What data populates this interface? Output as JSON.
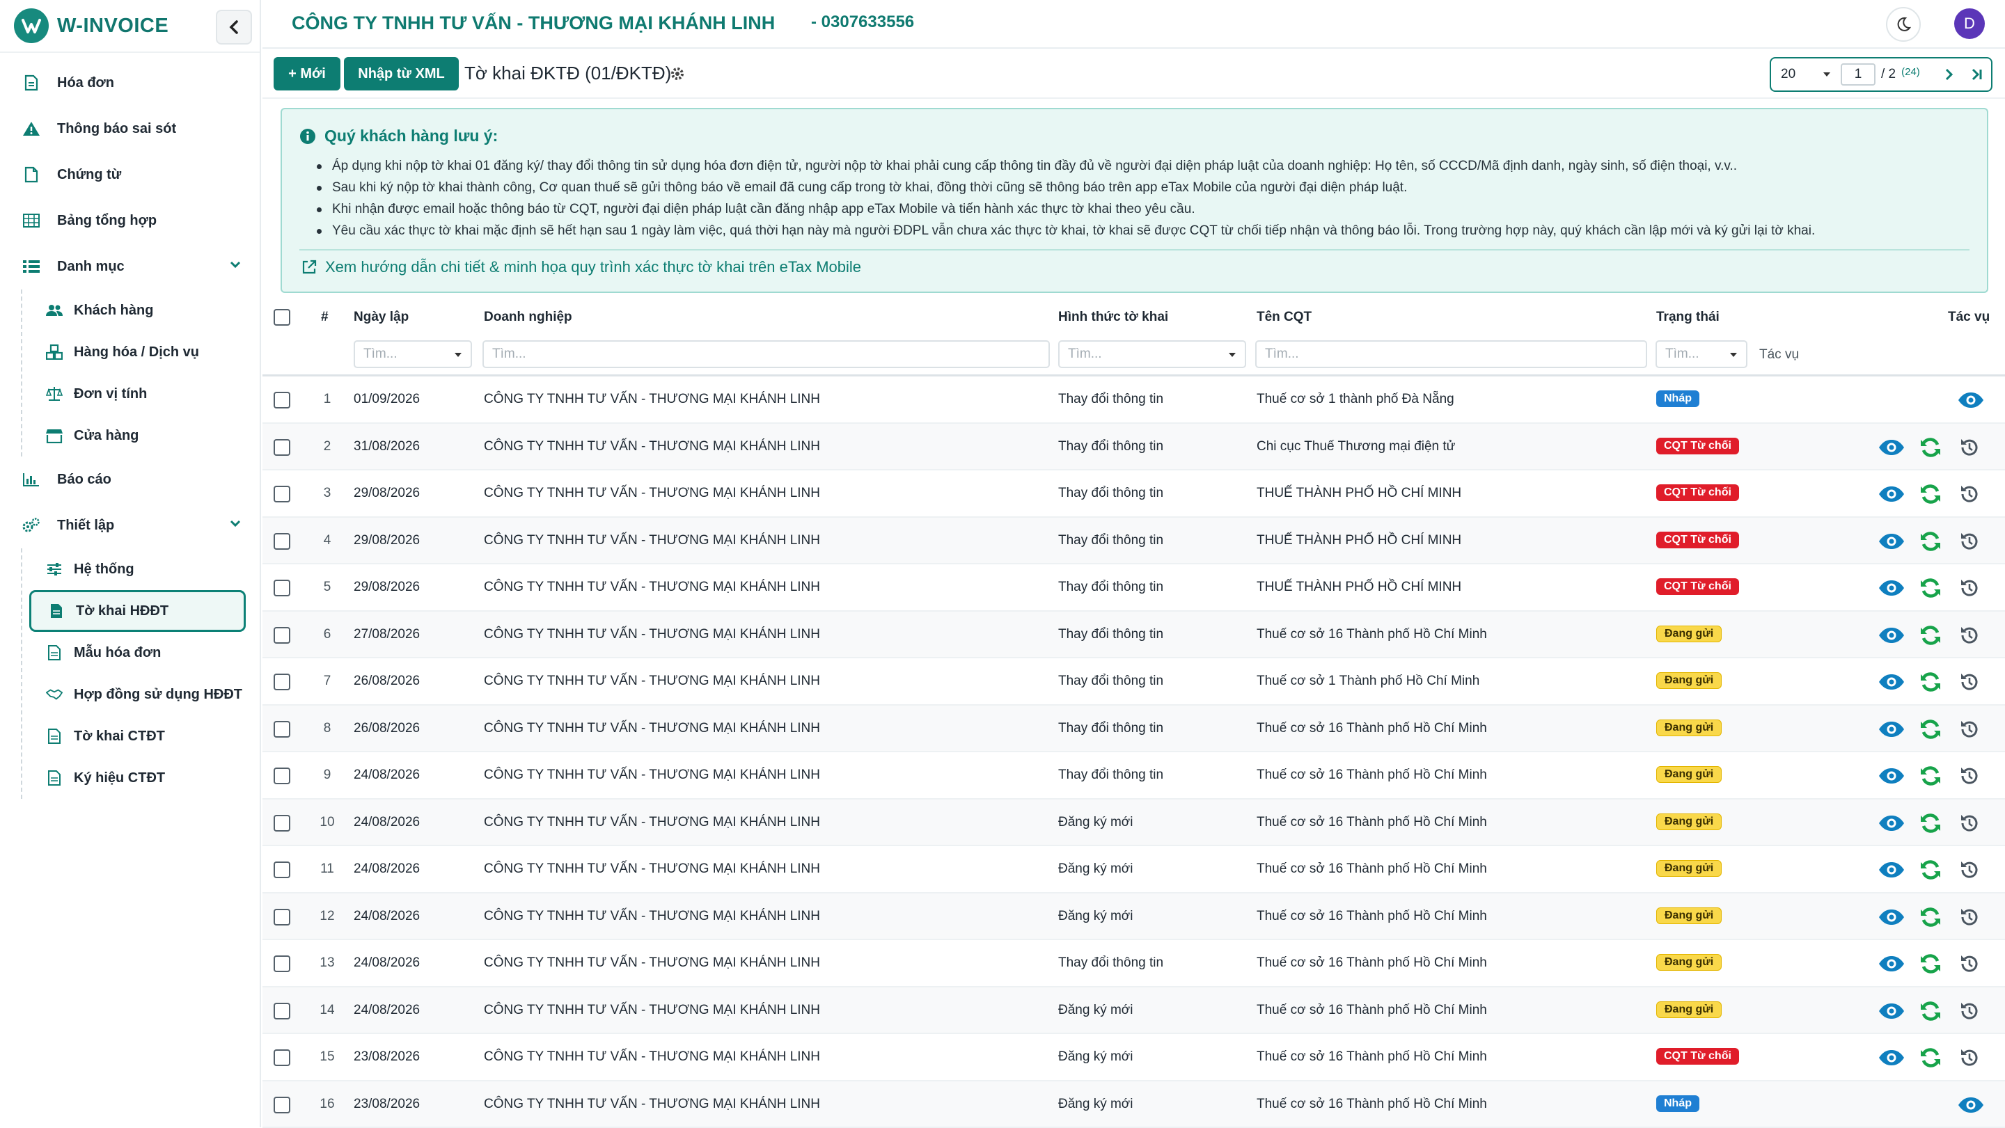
{
  "sidebar": {
    "brand": "W-INVOICE",
    "items": [
      {
        "label": "Hóa đơn"
      },
      {
        "label": "Thông báo sai sót"
      },
      {
        "label": "Chứng từ"
      },
      {
        "label": "Bảng tổng hợp"
      },
      {
        "label": "Danh mục"
      },
      {
        "label": "Báo cáo"
      },
      {
        "label": "Thiết lập"
      }
    ],
    "danh_muc": [
      {
        "label": "Khách hàng"
      },
      {
        "label": "Hàng hóa / Dịch vụ"
      },
      {
        "label": "Đơn vị tính"
      },
      {
        "label": "Cửa hàng"
      }
    ],
    "thiet_lap": [
      {
        "label": "Hệ thống"
      },
      {
        "label": "Tờ khai HĐĐT"
      },
      {
        "label": "Mẫu hóa đơn"
      },
      {
        "label": "Hợp đồng sử dụng HĐĐT"
      },
      {
        "label": "Tờ khai CTĐT"
      },
      {
        "label": "Ký hiệu CTĐT"
      }
    ]
  },
  "header": {
    "company": "CÔNG TY TNHH TƯ VẤN - THƯƠNG MẠI KHÁNH LINH",
    "taxcode": "- 0307633556",
    "avatar": "D"
  },
  "toolbar": {
    "new_label": "+ Mới",
    "import_label": "Nhập từ XML",
    "title": "Tờ khai ĐKTĐ (01/ĐKTĐ)"
  },
  "pager": {
    "page_size": "20",
    "page": "1",
    "total_pages": "/ 2",
    "total": "(24)"
  },
  "notice": {
    "title": "Quý khách hàng lưu ý:",
    "items": [
      "Áp dụng khi nộp tờ khai 01 đăng ký/ thay đổi thông tin sử dụng hóa đơn điện tử, người nộp tờ khai phải cung cấp thông tin đầy đủ về người đại diện pháp luật của doanh nghiệp: Họ tên, số CCCD/Mã định danh, ngày sinh, số điện thoại, v.v..",
      "Sau khi ký nộp tờ khai thành công, Cơ quan thuế sẽ gửi thông báo về email đã cung cấp trong tờ khai, đồng thời cũng sẽ thông báo trên app eTax Mobile của người đại diện pháp luật.",
      "Khi nhận được email hoặc thông báo từ CQT, người đại diện pháp luật cần đăng nhập app eTax Mobile và tiến hành xác thực tờ khai theo yêu cầu.",
      "Yêu cầu xác thực tờ khai mặc định sẽ hết hạn sau 1 ngày làm việc, quá thời hạn này mà người ĐDPL vẫn chưa xác thực tờ khai, tờ khai sẽ được CQT từ chối tiếp nhận và thông báo lỗi. Trong trường hợp này, quý khách cần lập mới và ký gửi lại tờ khai."
    ],
    "link": "Xem hướng dẫn chi tiết & minh họa quy trình xác thực tờ khai trên eTax Mobile"
  },
  "table": {
    "headers": {
      "num": "#",
      "date": "Ngày lập",
      "company": "Doanh nghiệp",
      "type": "Hình thức tờ khai",
      "cqt": "Tên CQT",
      "status": "Trạng thái",
      "actions": "Tác vụ"
    },
    "filter_placeholder": "Tìm...",
    "filter_actions": "Tác vụ",
    "rows": [
      {
        "num": "1",
        "date": "01/09/2026",
        "company": "CÔNG TY TNHH TƯ VẤN - THƯƠNG MẠI KHÁNH LINH",
        "type": "Thay đổi thông tin",
        "cqt": "Thuế cơ sở 1 thành phố Đà Nẵng",
        "status": "Nháp",
        "status_kind": "nhap"
      },
      {
        "num": "2",
        "date": "31/08/2026",
        "company": "CÔNG TY TNHH TƯ VẤN - THƯƠNG MẠI KHÁNH LINH",
        "type": "Thay đổi thông tin",
        "cqt": "Chi cục Thuế Thương mại điện tử",
        "status": "CQT Từ chối",
        "status_kind": "tuchoi"
      },
      {
        "num": "3",
        "date": "29/08/2026",
        "company": "CÔNG TY TNHH TƯ VẤN - THƯƠNG MẠI KHÁNH LINH",
        "type": "Thay đổi thông tin",
        "cqt": "THUẾ THÀNH PHỐ HỒ CHÍ MINH",
        "status": "CQT Từ chối",
        "status_kind": "tuchoi"
      },
      {
        "num": "4",
        "date": "29/08/2026",
        "company": "CÔNG TY TNHH TƯ VẤN - THƯƠNG MẠI KHÁNH LINH",
        "type": "Thay đổi thông tin",
        "cqt": "THUẾ THÀNH PHỐ HỒ CHÍ MINH",
        "status": "CQT Từ chối",
        "status_kind": "tuchoi"
      },
      {
        "num": "5",
        "date": "29/08/2026",
        "company": "CÔNG TY TNHH TƯ VẤN - THƯƠNG MẠI KHÁNH LINH",
        "type": "Thay đổi thông tin",
        "cqt": "THUẾ THÀNH PHỐ HỒ CHÍ MINH",
        "status": "CQT Từ chối",
        "status_kind": "tuchoi"
      },
      {
        "num": "6",
        "date": "27/08/2026",
        "company": "CÔNG TY TNHH TƯ VẤN - THƯƠNG MẠI KHÁNH LINH",
        "type": "Thay đổi thông tin",
        "cqt": "Thuế cơ sở 16 Thành phố Hồ Chí Minh",
        "status": "Đang gửi",
        "status_kind": "danggui"
      },
      {
        "num": "7",
        "date": "26/08/2026",
        "company": "CÔNG TY TNHH TƯ VẤN - THƯƠNG MẠI KHÁNH LINH",
        "type": "Thay đổi thông tin",
        "cqt": "Thuế cơ sở 1 Thành phố Hồ Chí Minh",
        "status": "Đang gửi",
        "status_kind": "danggui"
      },
      {
        "num": "8",
        "date": "26/08/2026",
        "company": "CÔNG TY TNHH TƯ VẤN - THƯƠNG MẠI KHÁNH LINH",
        "type": "Thay đổi thông tin",
        "cqt": "Thuế cơ sở 16 Thành phố Hồ Chí Minh",
        "status": "Đang gửi",
        "status_kind": "danggui"
      },
      {
        "num": "9",
        "date": "24/08/2026",
        "company": "CÔNG TY TNHH TƯ VẤN - THƯƠNG MẠI KHÁNH LINH",
        "type": "Thay đổi thông tin",
        "cqt": "Thuế cơ sở 16 Thành phố Hồ Chí Minh",
        "status": "Đang gửi",
        "status_kind": "danggui"
      },
      {
        "num": "10",
        "date": "24/08/2026",
        "company": "CÔNG TY TNHH TƯ VẤN - THƯƠNG MẠI KHÁNH LINH",
        "type": "Đăng ký mới",
        "cqt": "Thuế cơ sở 16 Thành phố Hồ Chí Minh",
        "status": "Đang gửi",
        "status_kind": "danggui"
      },
      {
        "num": "11",
        "date": "24/08/2026",
        "company": "CÔNG TY TNHH TƯ VẤN - THƯƠNG MẠI KHÁNH LINH",
        "type": "Đăng ký mới",
        "cqt": "Thuế cơ sở 16 Thành phố Hồ Chí Minh",
        "status": "Đang gửi",
        "status_kind": "danggui"
      },
      {
        "num": "12",
        "date": "24/08/2026",
        "company": "CÔNG TY TNHH TƯ VẤN - THƯƠNG MẠI KHÁNH LINH",
        "type": "Đăng ký mới",
        "cqt": "Thuế cơ sở 16 Thành phố Hồ Chí Minh",
        "status": "Đang gửi",
        "status_kind": "danggui"
      },
      {
        "num": "13",
        "date": "24/08/2026",
        "company": "CÔNG TY TNHH TƯ VẤN - THƯƠNG MẠI KHÁNH LINH",
        "type": "Thay đổi thông tin",
        "cqt": "Thuế cơ sở 16 Thành phố Hồ Chí Minh",
        "status": "Đang gửi",
        "status_kind": "danggui"
      },
      {
        "num": "14",
        "date": "24/08/2026",
        "company": "CÔNG TY TNHH TƯ VẤN - THƯƠNG MẠI KHÁNH LINH",
        "type": "Đăng ký mới",
        "cqt": "Thuế cơ sở 16 Thành phố Hồ Chí Minh",
        "status": "Đang gửi",
        "status_kind": "danggui"
      },
      {
        "num": "15",
        "date": "23/08/2026",
        "company": "CÔNG TY TNHH TƯ VẤN - THƯƠNG MẠI KHÁNH LINH",
        "type": "Đăng ký mới",
        "cqt": "Thuế cơ sở 16 Thành phố Hồ Chí Minh",
        "status": "CQT Từ chối",
        "status_kind": "tuchoi"
      },
      {
        "num": "16",
        "date": "23/08/2026",
        "company": "CÔNG TY TNHH TƯ VẤN - THƯƠNG MẠI KHÁNH LINH",
        "type": "Đăng ký mới",
        "cqt": "Thuế cơ sở 16 Thành phố Hồ Chí Minh",
        "status": "Nháp",
        "status_kind": "nhap"
      }
    ]
  },
  "colors": {
    "brand": "#0d7d72",
    "draft": "#1f7fd3",
    "rejected": "#e01d2a",
    "sending": "#f9d84a"
  }
}
